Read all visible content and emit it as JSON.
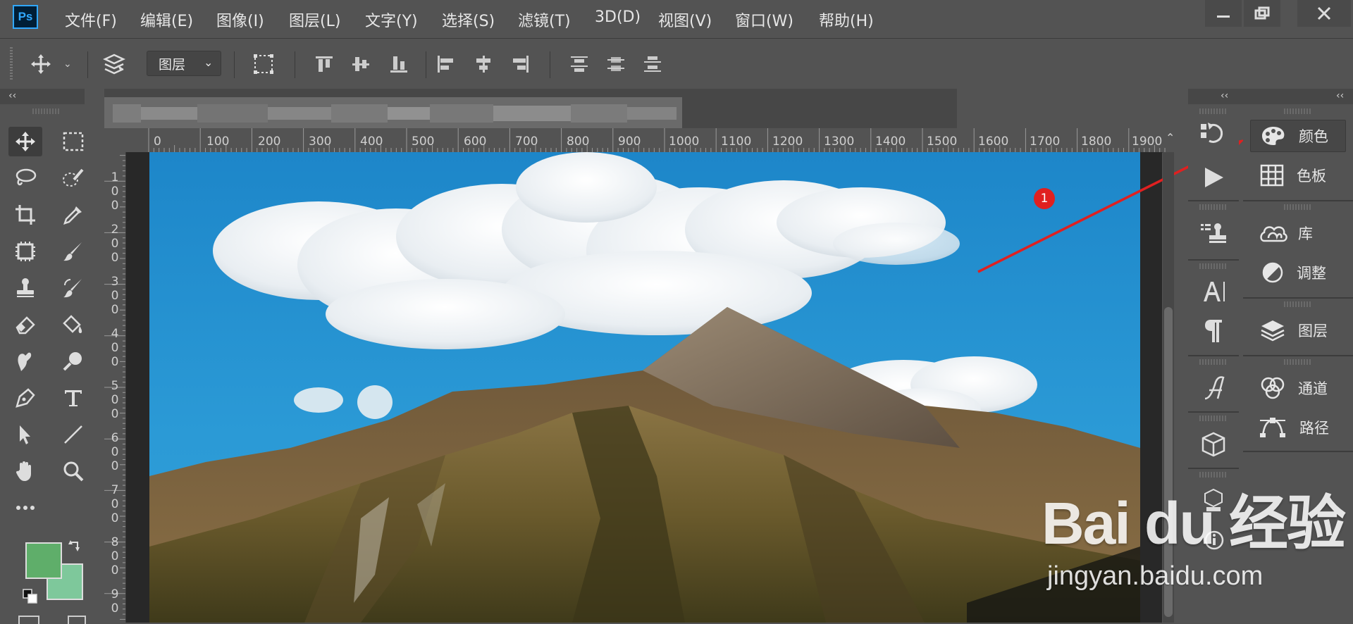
{
  "app": {
    "logo": "Ps"
  },
  "menu": [
    "文件(F)",
    "编辑(E)",
    "图像(I)",
    "图层(L)",
    "文字(Y)",
    "选择(S)",
    "滤镜(T)",
    "3D(D)",
    "视图(V)",
    "窗口(W)",
    "帮助(H)"
  ],
  "options_bar": {
    "auto_select_target": "图层"
  },
  "collapse_glyph": "‹‹",
  "ruler": {
    "top_ticks": [
      "0",
      "100",
      "200",
      "300",
      "400",
      "500",
      "600",
      "700",
      "800",
      "900",
      "1000",
      "1100",
      "1200",
      "1300",
      "1400",
      "1500",
      "1600",
      "1700",
      "1800",
      "1900"
    ],
    "left_ticks": [
      [
        "1",
        "0",
        "0"
      ],
      [
        "2",
        "0",
        "0"
      ],
      [
        "3",
        "0",
        "0"
      ],
      [
        "4",
        "0",
        "0"
      ],
      [
        "5",
        "0",
        "0"
      ],
      [
        "6",
        "0",
        "0"
      ],
      [
        "7",
        "0",
        "0"
      ],
      [
        "8",
        "0",
        "0"
      ],
      [
        "9",
        "0"
      ]
    ]
  },
  "dock_panels": [
    {
      "label": "颜色",
      "icon": "palette-icon",
      "group": 1
    },
    {
      "label": "色板",
      "icon": "swatches-grid-icon",
      "group": 1
    },
    {
      "label": "库",
      "icon": "libraries-icon",
      "group": 2
    },
    {
      "label": "调整",
      "icon": "adjustments-icon",
      "group": 2
    },
    {
      "label": "图层",
      "icon": "layers-icon",
      "group": 3
    },
    {
      "label": "通道",
      "icon": "channels-icon",
      "group": 4
    },
    {
      "label": "路径",
      "icon": "paths-icon",
      "group": 4
    }
  ],
  "colors": {
    "foreground": "#5fae6a",
    "background": "#7ec89b",
    "annotation_red": "#e02020"
  },
  "annotation": {
    "badge": "1"
  },
  "watermark": {
    "brand": "Bai du 经验",
    "url": "jingyan.baidu.com"
  }
}
